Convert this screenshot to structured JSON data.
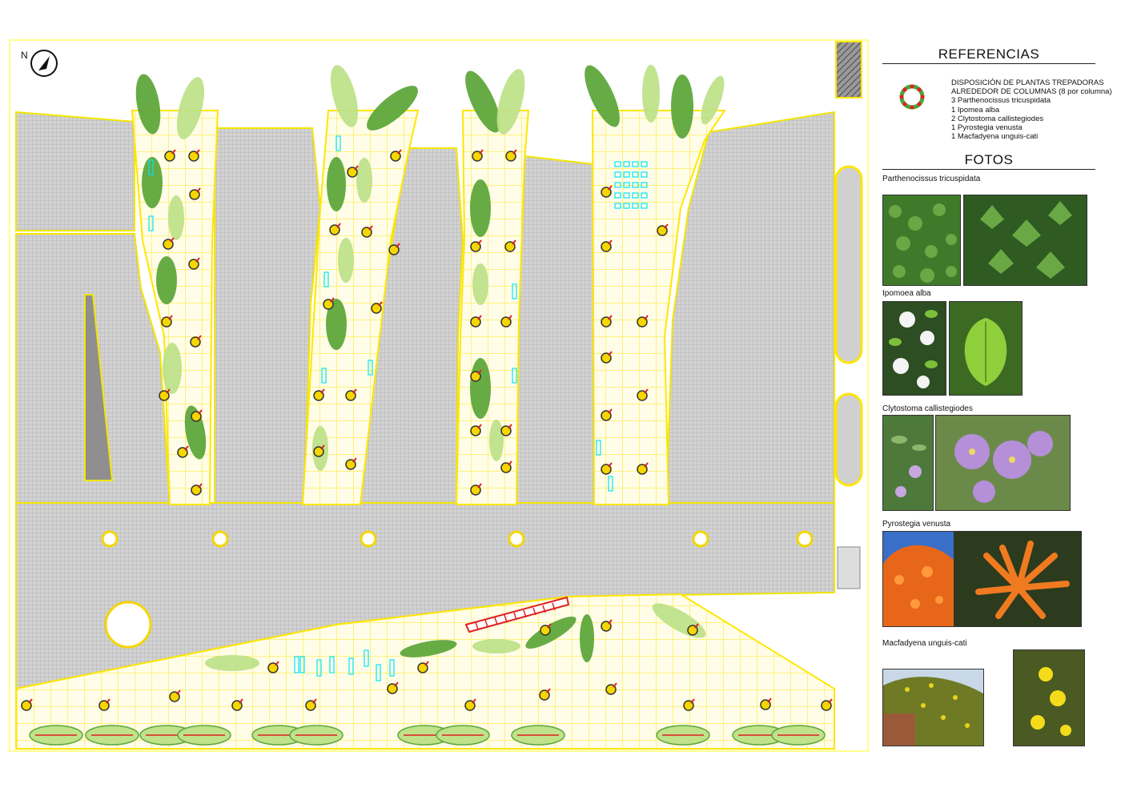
{
  "plan": {
    "north_label": "N",
    "colors": {
      "paving": "#c8c8c8",
      "grid_line": "#ffff33",
      "garden_bg": "#fffde0",
      "leaf_dark": "#5fa73c",
      "leaf_light": "#bfe28a",
      "planter": "#f5d600",
      "accent_red": "#e02020",
      "accent_cyan": "#00e5ff"
    }
  },
  "references": {
    "title": "REFERENCIAS",
    "legend_icon": "column-climbers-ring-icon",
    "legend_lines": [
      "DISPOSICIÓN DE PLANTAS TREPADORAS",
      "ALREDEDOR DE COLUMNAS (8 por columna)",
      "3 Parthenocissus tricuspidata",
      "1 Ipomea alba",
      "2 Clytostoma callistegiodes",
      "1 Pyrostegia venusta",
      "1 Macfadyena unguis-cati"
    ]
  },
  "photos": {
    "title": "FOTOS",
    "species": [
      {
        "name": "Parthenocissus tricuspidata",
        "colors": [
          "#3f7a2a",
          "#6aa845"
        ]
      },
      {
        "name": "Ipomoea alba",
        "colors": [
          "#2f5f22",
          "#7cbf3a"
        ]
      },
      {
        "name": "Clytostoma callistegiodes",
        "colors": [
          "#4d7a3a",
          "#b58fd8"
        ]
      },
      {
        "name": "Pyrostegia venusta",
        "colors": [
          "#e8661a",
          "#f07a20"
        ]
      },
      {
        "name": "Macfadyena unguis-cati",
        "colors": [
          "#6f7a25",
          "#e8d21c"
        ]
      }
    ]
  }
}
